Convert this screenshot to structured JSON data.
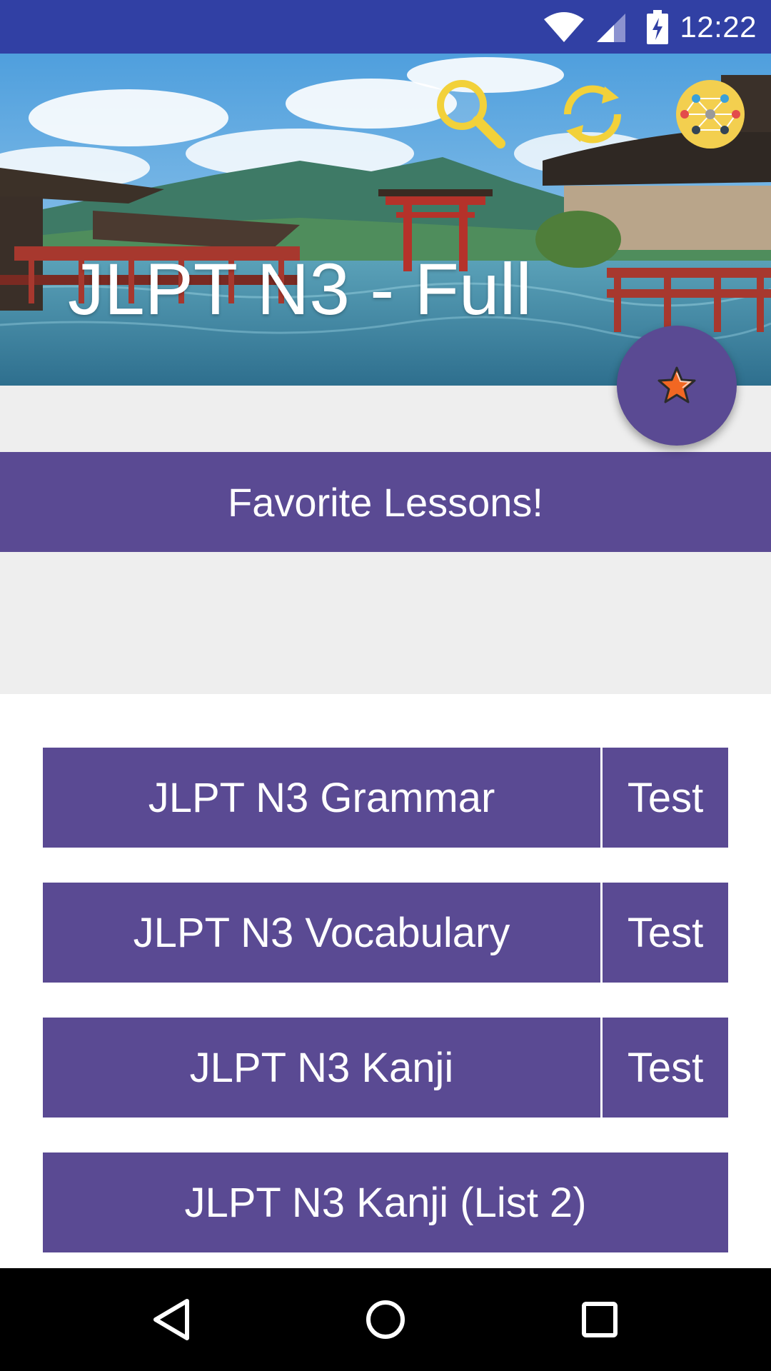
{
  "status_bar": {
    "time": "12:22",
    "icons": [
      "wifi-icon",
      "signal-icon",
      "battery-charging-icon"
    ]
  },
  "header": {
    "title": "JLPT N3 - Full",
    "toolbar_icons": [
      "search-icon",
      "sync-icon",
      "network-icon"
    ]
  },
  "favorites": {
    "label": "Favorite Lessons!",
    "fab_icon": "star-icon"
  },
  "lessons": [
    {
      "label": "JLPT N3 Grammar",
      "test_label": "Test"
    },
    {
      "label": "JLPT N3 Vocabulary",
      "test_label": "Test"
    },
    {
      "label": "JLPT N3 Kanji",
      "test_label": "Test"
    },
    {
      "label": "JLPT N3 Kanji (List 2)"
    }
  ],
  "nav_bar": {
    "icons": [
      "back-icon",
      "home-icon",
      "recents-icon"
    ]
  },
  "colors": {
    "status_bar": "#3140a4",
    "accent_purple": "#5a4a93",
    "grey_background": "#eeeeee",
    "icon_yellow": "#f2d13a",
    "star_orange": "#f26722"
  }
}
